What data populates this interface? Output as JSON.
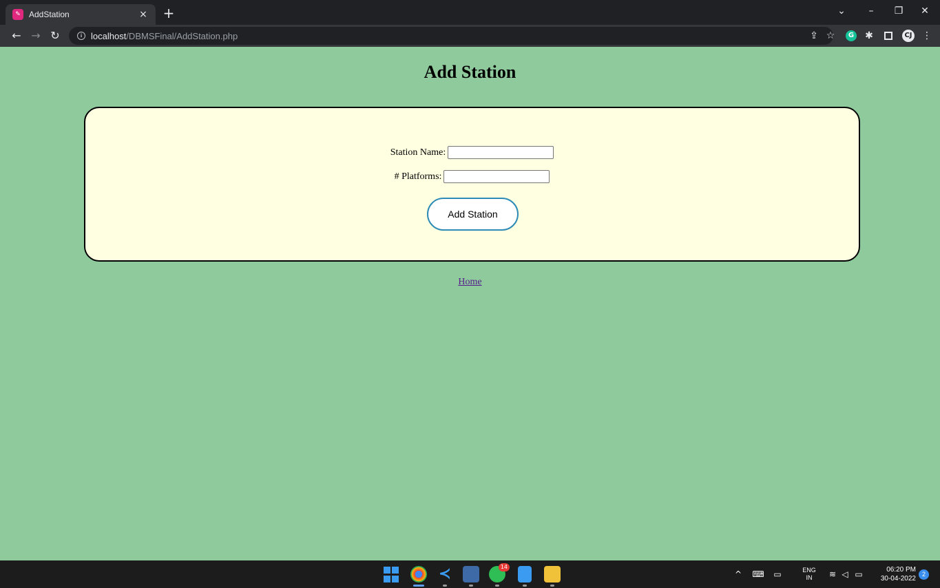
{
  "browser": {
    "tab_title": "AddStation",
    "new_tab_symbol": "+",
    "tab_close_symbol": "×",
    "url_host": "localhost",
    "url_path": "/DBMSFinal/AddStation.php",
    "favicon_color": "#e0287e",
    "extension_letter": "G",
    "profile_letter": "CJ"
  },
  "page": {
    "title": "Add Station",
    "background_color": "#8fca9d",
    "card_color": "#ffffe1",
    "form": {
      "station_name_label": "Station Name:",
      "station_name_value": "",
      "platforms_label": "# Platforms:",
      "platforms_value": "",
      "submit_label": "Add Station"
    },
    "home_link": "Home"
  },
  "taskbar": {
    "whatsapp_badge": "14",
    "language_top": "ENG",
    "language_bottom": "IN",
    "time": "06:20 PM",
    "date": "30-04-2022",
    "notification_count": "2"
  }
}
